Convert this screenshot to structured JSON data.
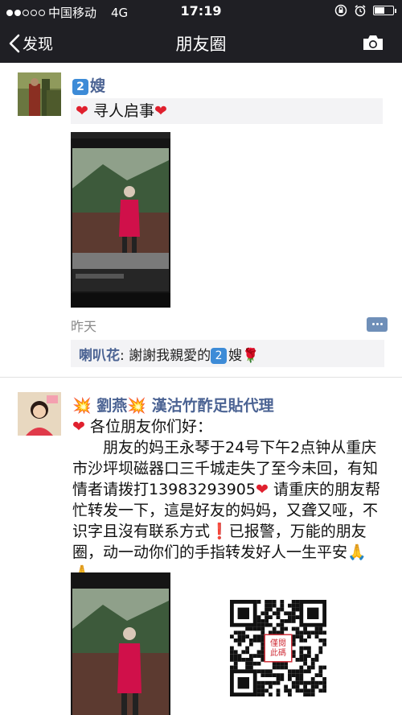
{
  "status": {
    "carrier": "中国移动",
    "network": "4G",
    "time": "17:19",
    "signal_bars": 2,
    "battery_level": 0.55
  },
  "nav": {
    "back_label": "发现",
    "title": "朋友圈"
  },
  "post1": {
    "author": "嫂",
    "author_badge": "2",
    "text": "寻人启事",
    "time": "昨天",
    "comment": {
      "author": "喇叭花",
      "text": "謝謝我親愛的",
      "badge": "2",
      "suffix": "嫂"
    }
  },
  "post2": {
    "author": "劉燕",
    "author_suffix": "漢沽竹酢足貼代理",
    "lines": [
      "各位朋友你们好：",
      "朋友的妈王永琴于24号下午2点钟从重庆",
      "市沙坪坝磁器口三千城走失了至今未回，有知",
      "情者请拨打13983293905",
      "请重庆的朋友帮",
      "忙转发一下，這是好友的妈妈，又聋又哑，不",
      "识字且沒有联系方式",
      "已报警，万能的朋友",
      "圈，动一动你们的手指转发好人一生平安"
    ],
    "qr_stamp": "僅閱此碼"
  },
  "colors": {
    "nav_bg": "#1f1f24",
    "link": "#4b6393",
    "heart": "#e0202e"
  }
}
